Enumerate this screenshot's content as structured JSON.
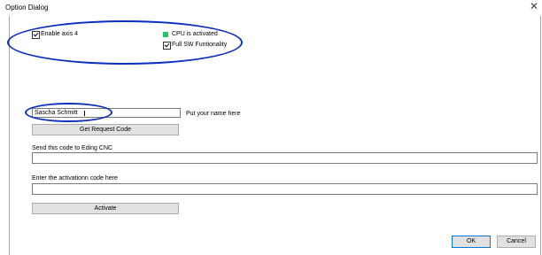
{
  "window": {
    "title": "Option Dialog",
    "close_glyph": "✕"
  },
  "options": {
    "enable_axis4": {
      "label": "Enable axis 4",
      "checked": true
    },
    "cpu_status": {
      "label": "CPU is activated",
      "indicator_color": "#22c55e"
    },
    "full_sw": {
      "label": "Full SW Funtionality",
      "checked": true
    }
  },
  "name_section": {
    "name_value": "Sascha Schmitt",
    "hint": "Put your name here",
    "request_button": "Get Request Code"
  },
  "code_section": {
    "send_label": "Send this code to Eding CNC",
    "send_value": "",
    "enter_label": "Enter the activationn code here",
    "enter_value": "",
    "activate_button": "Activate"
  },
  "footer": {
    "ok_button": "OK",
    "cancel_button": "Cancel"
  },
  "annotations": {
    "color": "#0a2ec0"
  }
}
